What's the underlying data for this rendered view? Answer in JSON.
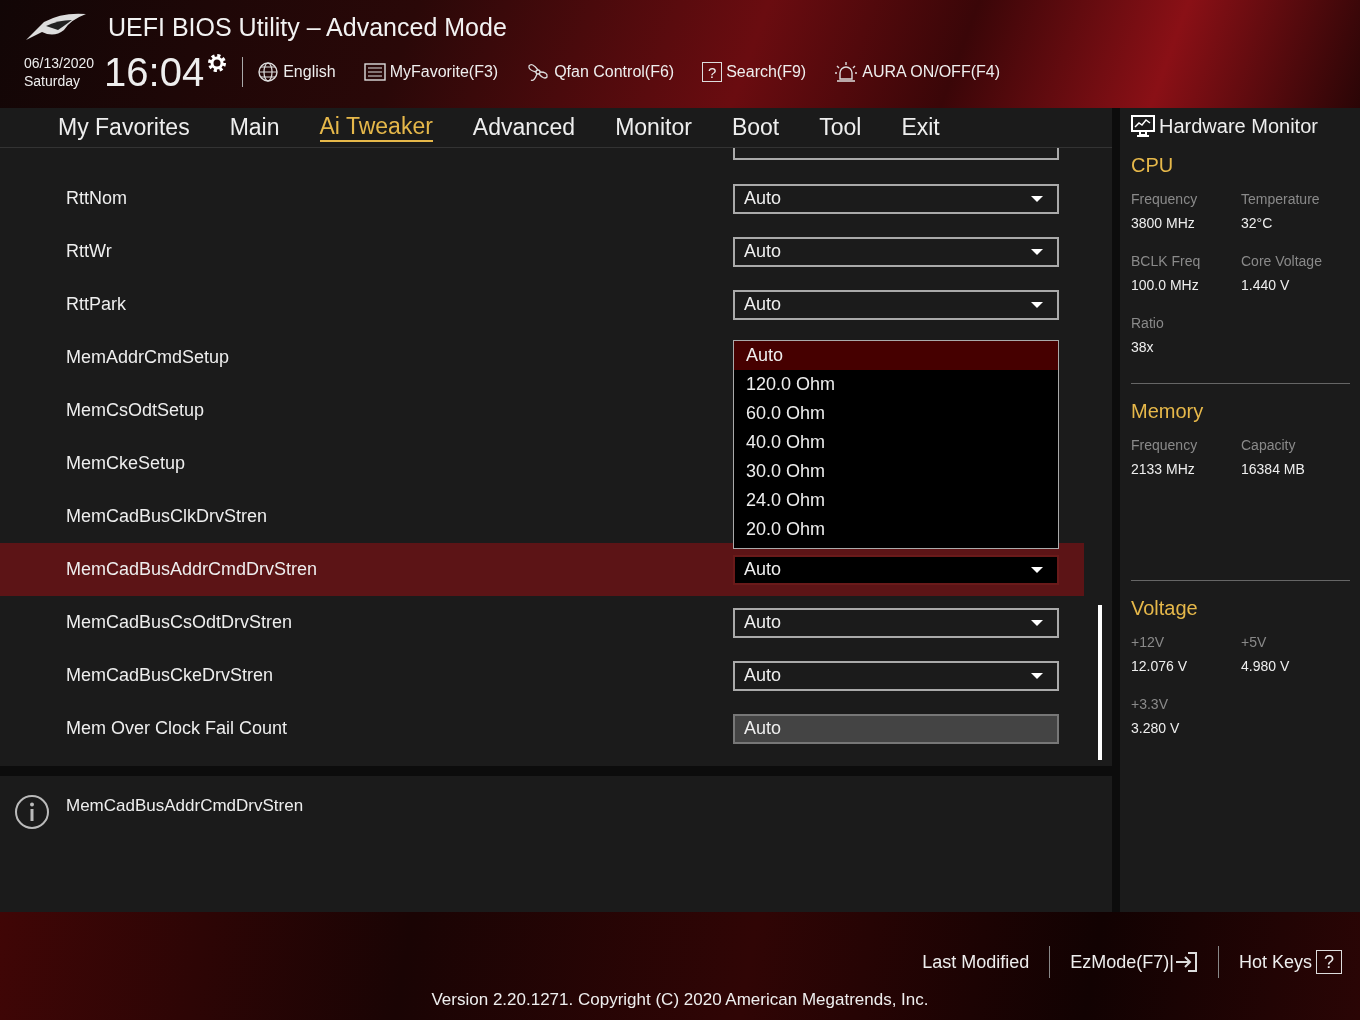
{
  "header": {
    "title": "UEFI BIOS Utility – Advanced Mode",
    "date": "06/13/2020",
    "day": "Saturday",
    "time": "16:04",
    "toolbar": [
      {
        "kind": "globe",
        "label": "English"
      },
      {
        "kind": "list",
        "label": "MyFavorite(F3)"
      },
      {
        "kind": "fan",
        "label": "Qfan Control(F6)"
      },
      {
        "kind": "question",
        "glyph": "?",
        "label": "Search(F9)"
      },
      {
        "kind": "aura",
        "label": "AURA ON/OFF(F4)"
      }
    ]
  },
  "tabs": [
    {
      "label": "My Favorites",
      "selected": false
    },
    {
      "label": "Main",
      "selected": false
    },
    {
      "label": "Ai Tweaker",
      "selected": true
    },
    {
      "label": "Advanced",
      "selected": false
    },
    {
      "label": "Monitor",
      "selected": false
    },
    {
      "label": "Boot",
      "selected": false
    },
    {
      "label": "Tool",
      "selected": false
    },
    {
      "label": "Exit",
      "selected": false
    }
  ],
  "settings": [
    {
      "label": "RttNom",
      "kind": "dropdown",
      "value": "Auto",
      "selected": false
    },
    {
      "label": "RttWr",
      "kind": "dropdown",
      "value": "Auto",
      "selected": false
    },
    {
      "label": "RttPark",
      "kind": "dropdown",
      "value": "Auto",
      "selected": false
    },
    {
      "label": "MemAddrCmdSetup",
      "kind": "covered",
      "selected": false
    },
    {
      "label": "MemCsOdtSetup",
      "kind": "covered",
      "selected": false
    },
    {
      "label": "MemCkeSetup",
      "kind": "covered",
      "selected": false
    },
    {
      "label": "MemCadBusClkDrvStren",
      "kind": "covered",
      "selected": false
    },
    {
      "label": "MemCadBusAddrCmdDrvStren",
      "kind": "dropdown",
      "value": "Auto",
      "selected": true
    },
    {
      "label": "MemCadBusCsOdtDrvStren",
      "kind": "dropdown",
      "value": "Auto",
      "selected": false
    },
    {
      "label": "MemCadBusCkeDrvStren",
      "kind": "dropdown",
      "value": "Auto",
      "selected": false
    },
    {
      "label": "Mem Over Clock Fail Count",
      "kind": "field",
      "value": "Auto",
      "selected": false
    }
  ],
  "open_list": [
    {
      "label": "Auto",
      "selected": true
    },
    {
      "label": "120.0 Ohm",
      "selected": false
    },
    {
      "label": "60.0 Ohm",
      "selected": false
    },
    {
      "label": "40.0 Ohm",
      "selected": false
    },
    {
      "label": "30.0 Ohm",
      "selected": false
    },
    {
      "label": "24.0 Ohm",
      "selected": false
    },
    {
      "label": "20.0 Ohm",
      "selected": false
    }
  ],
  "help": {
    "text": "MemCadBusAddrCmdDrvStren"
  },
  "monitor": {
    "title": "Hardware Monitor",
    "sections": [
      {
        "title": "CPU",
        "items": [
          {
            "label": "Frequency",
            "value": "3800 MHz"
          },
          {
            "label": "Temperature",
            "value": "32°C"
          },
          {
            "label": "BCLK Freq",
            "value": "100.0 MHz"
          },
          {
            "label": "Core Voltage",
            "value": "1.440 V"
          },
          {
            "label": "Ratio",
            "value": "38x"
          }
        ]
      },
      {
        "title": "Memory",
        "items": [
          {
            "label": "Frequency",
            "value": "2133 MHz"
          },
          {
            "label": "Capacity",
            "value": "16384 MB"
          }
        ]
      },
      {
        "title": "Voltage",
        "items": [
          {
            "label": "+12V",
            "value": "12.076 V"
          },
          {
            "label": "+5V",
            "value": "4.980 V"
          },
          {
            "label": "+3.3V",
            "value": "3.280 V"
          }
        ]
      }
    ]
  },
  "footer": {
    "last_modified": "Last Modified",
    "ezmode": "EzMode(F7)|",
    "hotkeys": "Hot Keys",
    "hotkeys_glyph": "?",
    "version": "Version 2.20.1271. Copyright (C) 2020 American Megatrends, Inc."
  }
}
